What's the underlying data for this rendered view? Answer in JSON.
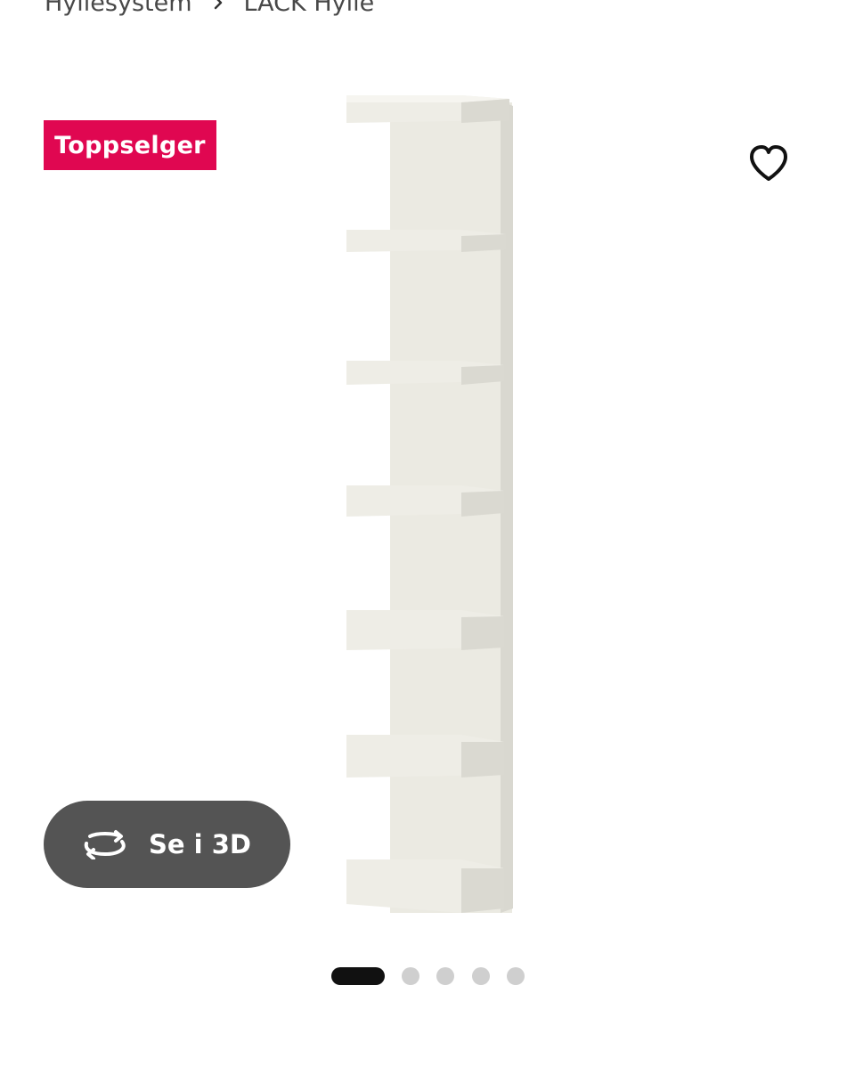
{
  "breadcrumb": {
    "items": [
      "Hyllesystem",
      "LACK Hylle"
    ]
  },
  "product": {
    "badge": "Toppselger",
    "badge_color": "#e00751",
    "favorite_icon": "heart-outline-icon",
    "image_alt": "LACK Hylle"
  },
  "viewer": {
    "view_3d_label": "Se i 3D",
    "view_3d_icon": "rotate-360-icon"
  },
  "carousel": {
    "total": 5,
    "active_index": 0
  }
}
